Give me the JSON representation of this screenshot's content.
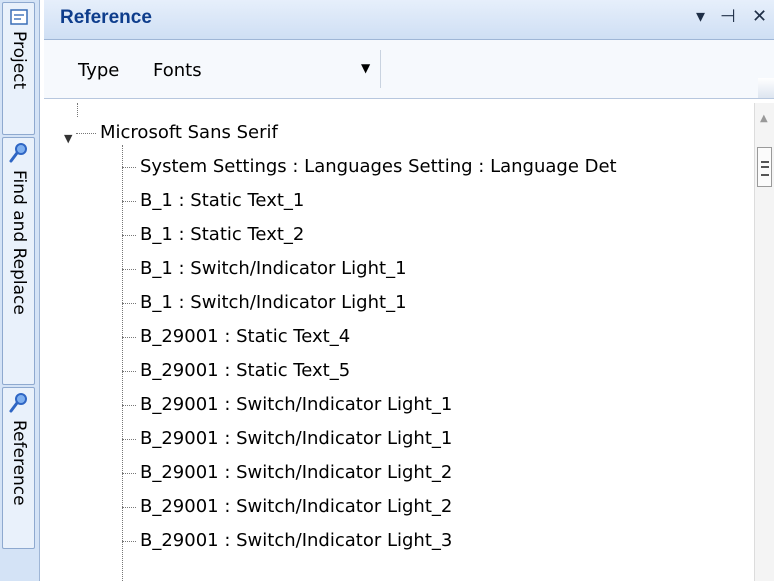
{
  "side_tabs": [
    {
      "label": "Project",
      "icon": "project-icon"
    },
    {
      "label": "Find and Replace",
      "icon": "magnifier-icon"
    },
    {
      "label": "Reference",
      "icon": "magnifier-icon"
    }
  ],
  "panel": {
    "title": "Reference",
    "buttons": [
      "▾",
      "⊣",
      "✕"
    ]
  },
  "toolbar": {
    "type_label": "Type",
    "type_value": "Fonts",
    "dropdown_arrow": "▼"
  },
  "tree": {
    "root": {
      "expander": "▼",
      "label": "Microsoft Sans Serif"
    },
    "children": [
      "System Settings : Languages Setting : Language Det",
      "B_1 : Static Text_1",
      "B_1 : Static Text_2",
      "B_1 : Switch/Indicator Light_1",
      "B_1 : Switch/Indicator Light_1",
      "B_29001 : Static Text_4",
      "B_29001 : Static Text_5",
      "B_29001 : Switch/Indicator Light_1",
      "B_29001 : Switch/Indicator Light_1",
      "B_29001 : Switch/Indicator Light_2",
      "B_29001 : Switch/Indicator Light_2",
      "B_29001 : Switch/Indicator Light_3"
    ]
  },
  "colors": {
    "accent": "#0e3d8c",
    "dock_bg": "#d4e3f6",
    "icon_blue": "#2f66c4"
  }
}
